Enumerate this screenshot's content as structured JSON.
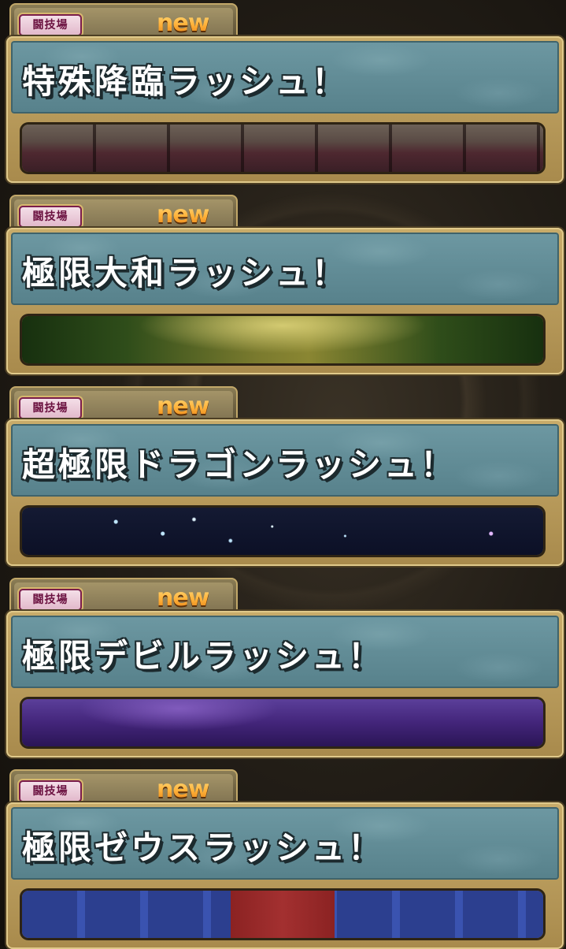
{
  "dungeons": [
    {
      "badge": "闘技場",
      "new_label": "new",
      "title": "特殊降臨ラッシュ！",
      "scene": "arena"
    },
    {
      "badge": "闘技場",
      "new_label": "new",
      "title": "極限大和ラッシュ！",
      "scene": "forest"
    },
    {
      "badge": "闘技場",
      "new_label": "new",
      "title": "超極限ドラゴンラッシュ！",
      "scene": "starry-night"
    },
    {
      "badge": "闘技場",
      "new_label": "new",
      "title": "極限デビルラッシュ！",
      "scene": "purple-night"
    },
    {
      "badge": "闘技場",
      "new_label": "new",
      "title": "極限ゼウスラッシュ！",
      "scene": "palace"
    }
  ]
}
